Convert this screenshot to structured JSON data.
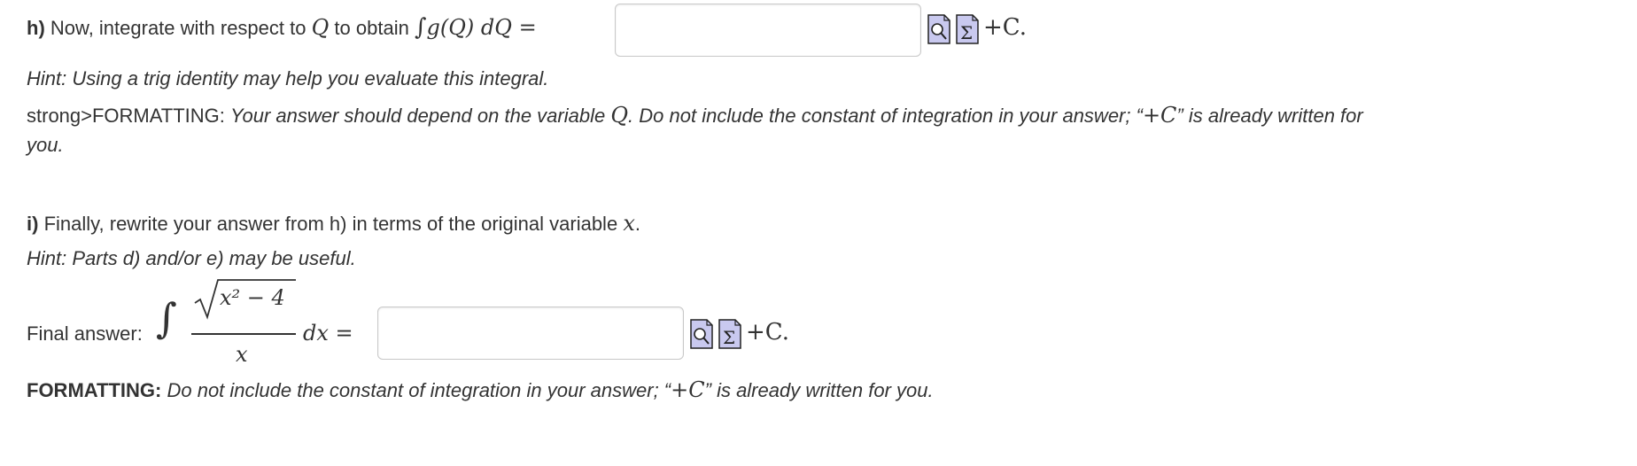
{
  "part_h": {
    "label": "h)",
    "prompt_text": "Now, integrate with respect to",
    "var": "Q",
    "obtain_text": "to obtain",
    "integral_expr": "g(Q) dQ =",
    "plus_c": "+C.",
    "answer_value": "",
    "hint": "Hint: Using a trig identity may help you evaluate this integral.",
    "formatting_prefix": "strong>FORMATTING:",
    "formatting_line1_a": "Your answer should depend on the variable",
    "formatting_var": "Q",
    "formatting_line1_b": ".  Do not include the constant of integration in your answer; “",
    "formatting_plusc": "+C",
    "formatting_line1_c": "” is already written for",
    "formatting_line2": "you."
  },
  "part_i": {
    "label": "i)",
    "prompt_text": "Finally, rewrite your answer from h) in terms of the original variable",
    "var": "x",
    "period": ".",
    "hint": "Hint: Parts d) and/or e) may be useful.",
    "final_label": "Final answer:",
    "numerator": "x² − 4",
    "denominator": "x",
    "dx": "dx =",
    "plus_c": "+C.",
    "answer_value": "",
    "formatting_label": "FORMATTING:",
    "formatting_a": "Do not include the constant of integration in your answer; “",
    "formatting_plusc": "+C",
    "formatting_b": "”  is already written for you."
  },
  "icons": [
    "preview-icon",
    "equation-editor-icon"
  ]
}
